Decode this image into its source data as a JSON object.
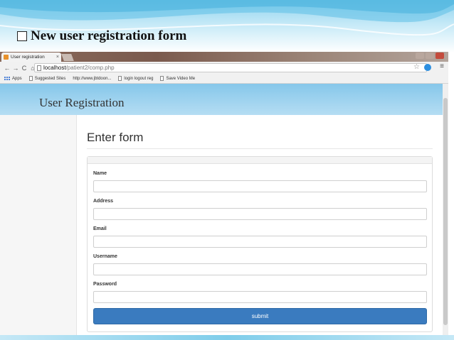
{
  "slide": {
    "title": "New user registration form"
  },
  "browser": {
    "tab_title": "User registration",
    "tab_close": "×",
    "url_host": "localhost",
    "url_path": "/patient2/comp.php",
    "nav": {
      "back": "←",
      "forward": "→",
      "reload": "C",
      "home": "⌂"
    },
    "star": "☆",
    "menu": "≡",
    "bookmarks": [
      "Apps",
      "Suggested Sites",
      "http://www.jbtdoon...",
      "login logout reg",
      "Save Video Me"
    ]
  },
  "page": {
    "site_title": "User Registration",
    "form_heading": "Enter form",
    "fields": [
      {
        "label": "Name",
        "value": ""
      },
      {
        "label": "Address",
        "value": ""
      },
      {
        "label": "Email",
        "value": ""
      },
      {
        "label": "Username",
        "value": ""
      },
      {
        "label": "Password",
        "value": ""
      }
    ],
    "submit_label": "submit"
  },
  "colors": {
    "accent": "#3a7bbf",
    "header": "#86c7ea"
  }
}
